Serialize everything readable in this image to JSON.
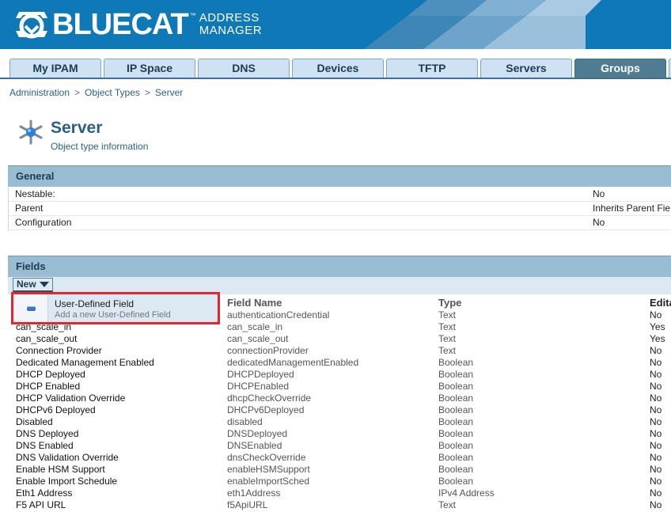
{
  "header": {
    "brand": "BLUECAT",
    "trademark": "™",
    "product_line1": "ADDRESS",
    "product_line2": "MANAGER",
    "colors": {
      "background": "#0f78b6",
      "deco": [
        "#3c86b8",
        "#6ea3cb",
        "#9bc0dc"
      ]
    }
  },
  "tabs": [
    {
      "label": "My IPAM",
      "active": false
    },
    {
      "label": "IP Space",
      "active": false
    },
    {
      "label": "DNS",
      "active": false
    },
    {
      "label": "Devices",
      "active": false
    },
    {
      "label": "TFTP",
      "active": false
    },
    {
      "label": "Servers",
      "active": false
    },
    {
      "label": "Groups",
      "active": true
    }
  ],
  "breadcrumb": [
    "Administration",
    "Object Types",
    "Server"
  ],
  "page": {
    "title": "Server",
    "subtitle": "Object type information",
    "icon": "server-object-icon"
  },
  "general": {
    "header": "General",
    "rows": [
      {
        "key": "Nestable:",
        "value": "No"
      },
      {
        "key": "Parent",
        "value": "Inherits Parent Fie"
      },
      {
        "key": "Configuration",
        "value": "No"
      }
    ]
  },
  "fields": {
    "header": "Fields",
    "new_button": "New",
    "menu": {
      "label": "User-Defined Field",
      "description": "Add a new User-Defined Field",
      "icon": "user-defined-field-icon",
      "highlight_color": "#e3262f"
    },
    "columns": [
      "Field Name",
      "Type",
      "Edita"
    ],
    "rows": [
      {
        "name": "",
        "field": "authenticationCredential",
        "type": "Text",
        "editable": "No"
      },
      {
        "name": "can_scale_in",
        "field": "can_scale_in",
        "type": "Text",
        "editable": "Yes"
      },
      {
        "name": "can_scale_out",
        "field": "can_scale_out",
        "type": "Text",
        "editable": "Yes"
      },
      {
        "name": "Connection Provider",
        "field": "connectionProvider",
        "type": "Text",
        "editable": "No"
      },
      {
        "name": "Dedicated Management Enabled",
        "field": "dedicatedManagementEnabled",
        "type": "Boolean",
        "editable": "No"
      },
      {
        "name": "DHCP Deployed",
        "field": "DHCPDeployed",
        "type": "Boolean",
        "editable": "No"
      },
      {
        "name": "DHCP Enabled",
        "field": "DHCPEnabled",
        "type": "Boolean",
        "editable": "No"
      },
      {
        "name": "DHCP Validation Override",
        "field": "dhcpCheckOverride",
        "type": "Boolean",
        "editable": "No"
      },
      {
        "name": "DHCPv6 Deployed",
        "field": "DHCPv6Deployed",
        "type": "Boolean",
        "editable": "No"
      },
      {
        "name": "Disabled",
        "field": "disabled",
        "type": "Boolean",
        "editable": "No"
      },
      {
        "name": "DNS Deployed",
        "field": "DNSDeployed",
        "type": "Boolean",
        "editable": "No"
      },
      {
        "name": "DNS Enabled",
        "field": "DNSEnabled",
        "type": "Boolean",
        "editable": "No"
      },
      {
        "name": "DNS Validation Override",
        "field": "dnsCheckOverride",
        "type": "Boolean",
        "editable": "No"
      },
      {
        "name": "Enable HSM Support",
        "field": "enableHSMSupport",
        "type": "Boolean",
        "editable": "No"
      },
      {
        "name": "Enable Import Schedule",
        "field": "enableImportSched",
        "type": "Boolean",
        "editable": "No"
      },
      {
        "name": "Eth1 Address",
        "field": "eth1Address",
        "type": "IPv4 Address",
        "editable": "No"
      },
      {
        "name": "F5 API URL",
        "field": "f5ApiURL",
        "type": "Text",
        "editable": "No"
      }
    ]
  }
}
